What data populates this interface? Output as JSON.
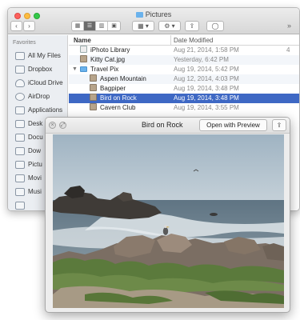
{
  "finder": {
    "title": "Pictures",
    "back_glyph": "‹",
    "forward_glyph": "›",
    "view_modes": [
      "▦",
      "☰",
      "▥",
      "▣"
    ],
    "arrange_glyph": "▦ ▾",
    "action_glyph": "⚙ ▾",
    "share_glyph": "⇪",
    "tag_glyph": "◯",
    "more_glyph": "»",
    "sidebar": {
      "heading": "Favorites",
      "items": [
        {
          "label": "All My Files",
          "icon": "all-files-icon"
        },
        {
          "label": "Dropbox",
          "icon": "dropbox-icon"
        },
        {
          "label": "iCloud Drive",
          "icon": "icloud-icon"
        },
        {
          "label": "AirDrop",
          "icon": "airdrop-icon"
        },
        {
          "label": "Applications",
          "icon": "applications-icon"
        },
        {
          "label": "Desk",
          "icon": "desktop-icon"
        },
        {
          "label": "Docu",
          "icon": "documents-icon"
        },
        {
          "label": "Dow",
          "icon": "downloads-icon"
        },
        {
          "label": "Pictu",
          "icon": "pictures-icon"
        },
        {
          "label": "Movi",
          "icon": "movies-icon"
        },
        {
          "label": "Musi",
          "icon": "music-icon"
        },
        {
          "label": "",
          "icon": "home-icon"
        }
      ]
    },
    "columns": {
      "name": "Name",
      "date": "Date Modified",
      "sort_glyph": "⌃"
    },
    "rows": [
      {
        "name": "iPhoto Library",
        "date": "Aug 21, 2014, 1:58 PM",
        "extra": "4",
        "kind": "file",
        "indent": 0
      },
      {
        "name": "Kitty Cat.jpg",
        "date": "Yesterday, 6:42 PM",
        "extra": "",
        "kind": "img",
        "indent": 0
      },
      {
        "name": "Travel Pix",
        "date": "Aug 19, 2014, 5:42 PM",
        "extra": "",
        "kind": "folder",
        "indent": 0,
        "disclosure": "▼"
      },
      {
        "name": "Aspen Mountain",
        "date": "Aug 12, 2014, 4:03 PM",
        "extra": "",
        "kind": "img",
        "indent": 1
      },
      {
        "name": "Bagpiper",
        "date": "Aug 19, 2014, 3:48 PM",
        "extra": "",
        "kind": "img",
        "indent": 1
      },
      {
        "name": "Bird on Rock",
        "date": "Aug 19, 2014, 3:48 PM",
        "extra": "",
        "kind": "img",
        "indent": 1,
        "selected": true
      },
      {
        "name": "Cavern Club",
        "date": "Aug 19, 2014, 3:55 PM",
        "extra": "",
        "kind": "img",
        "indent": 1
      }
    ]
  },
  "quicklook": {
    "title": "Bird on Rock",
    "close_glyph": "×",
    "fullscreen_glyph": "⤢",
    "open_button": "Open with Preview",
    "share_glyph": "⇪"
  }
}
